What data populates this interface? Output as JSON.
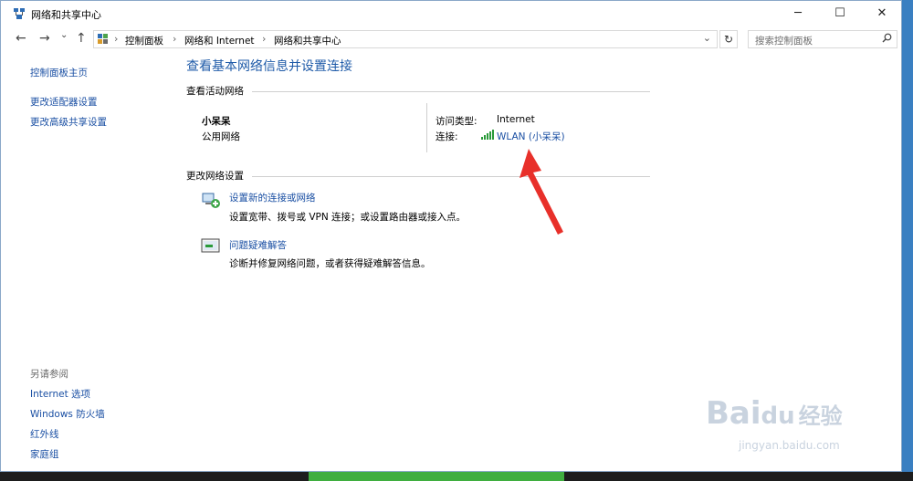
{
  "window": {
    "title": "网络和共享中心"
  },
  "controls": {
    "minimize": "─",
    "maximize": "☐",
    "close": "✕"
  },
  "nav": {
    "back": "←",
    "forward": "→",
    "dropdown": "⌄",
    "up": "↑",
    "refresh": "↻",
    "addr_dropdown": "⌄"
  },
  "breadcrumb": {
    "items": [
      "控制面板",
      "网络和 Internet",
      "网络和共享中心"
    ],
    "sep": "›"
  },
  "search": {
    "placeholder": "搜索控制面板",
    "icon": "search-icon"
  },
  "sidebar": {
    "home": "控制面板主页",
    "links": [
      "更改适配器设置",
      "更改高级共享设置"
    ],
    "see_also_title": "另请参阅",
    "see_also": [
      "Internet 选项",
      "Windows 防火墙",
      "红外线",
      "家庭组"
    ]
  },
  "main": {
    "title": "查看基本网络信息并设置连接",
    "active_section": "查看活动网络",
    "network": {
      "name": "小呆呆",
      "type": "公用网络",
      "access_label": "访问类型:",
      "access_value": "Internet",
      "conn_label": "连接:",
      "conn_value": "WLAN (小呆呆)"
    },
    "change_section": "更改网络设置",
    "tasks": [
      {
        "title": "设置新的连接或网络",
        "desc": "设置宽带、拨号或 VPN 连接；或设置路由器或接入点。",
        "icon": "network-setup-icon"
      },
      {
        "title": "问题疑难解答",
        "desc": "诊断并修复网络问题，或者获得疑难解答信息。",
        "icon": "troubleshoot-icon"
      }
    ]
  },
  "watermark": {
    "brand": "Bai",
    "brand2": "du",
    "brand_cn": "经验",
    "url": "jingyan.baidu.com"
  },
  "colors": {
    "link": "#1a4fa3",
    "title": "#1e5aa8",
    "arrow": "#e8302a"
  }
}
